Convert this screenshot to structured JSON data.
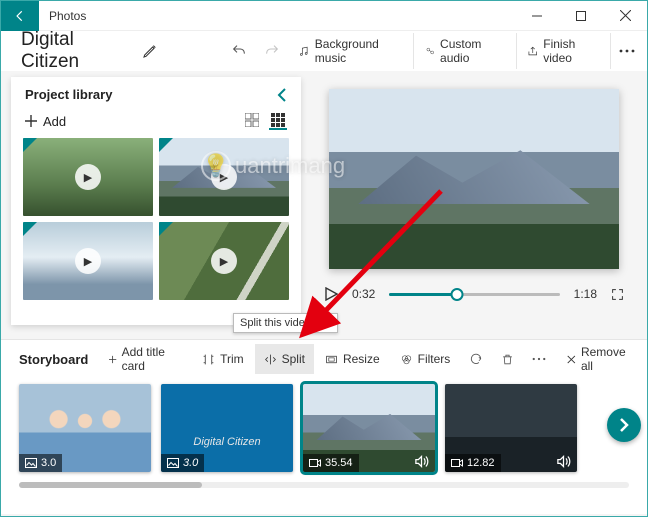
{
  "app": {
    "title": "Photos"
  },
  "project": {
    "name": "Digital Citizen"
  },
  "topbar": {
    "bg_music": "Background music",
    "custom_audio": "Custom audio",
    "finish": "Finish video"
  },
  "library": {
    "header": "Project library",
    "add": "Add"
  },
  "player": {
    "current_time": "0:32",
    "total_time": "1:18"
  },
  "storyboard": {
    "label": "Storyboard",
    "add_title": "Add title card",
    "trim": "Trim",
    "split": "Split",
    "resize": "Resize",
    "filters": "Filters",
    "remove_all": "Remove all",
    "tooltip": "Split this video clip",
    "clips": [
      {
        "duration": "3.0",
        "type": "image"
      },
      {
        "duration": "3.0",
        "type": "image",
        "caption": "Digital Citizen"
      },
      {
        "duration": "35.54",
        "type": "video"
      },
      {
        "duration": "12.82",
        "type": "video"
      }
    ]
  },
  "watermark": "uantrimang"
}
